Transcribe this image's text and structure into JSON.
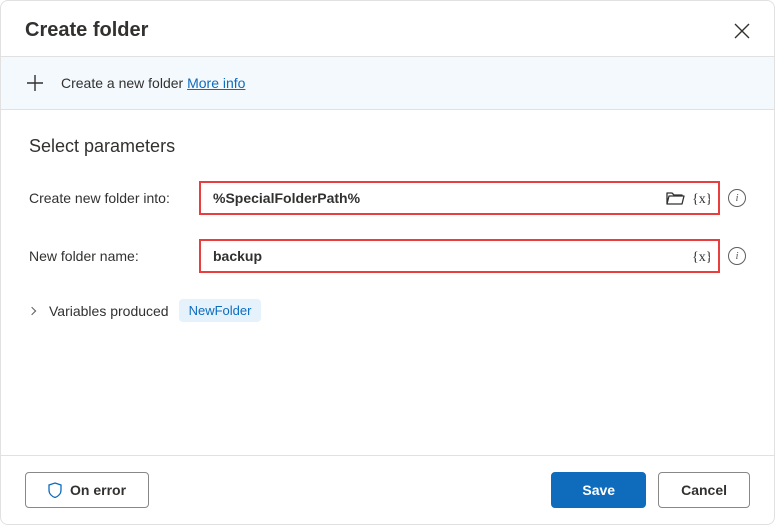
{
  "dialog": {
    "title": "Create folder",
    "infoBar": {
      "text": "Create a new folder ",
      "link": "More info"
    },
    "section": {
      "heading": "Select parameters",
      "param1": {
        "label": "Create new folder into:",
        "value": "%SpecialFolderPath%"
      },
      "param2": {
        "label": "New folder name:",
        "value": "backup"
      },
      "varsLabel": "Variables produced",
      "varTag": "NewFolder"
    },
    "footer": {
      "onError": "On error",
      "save": "Save",
      "cancel": "Cancel"
    }
  }
}
